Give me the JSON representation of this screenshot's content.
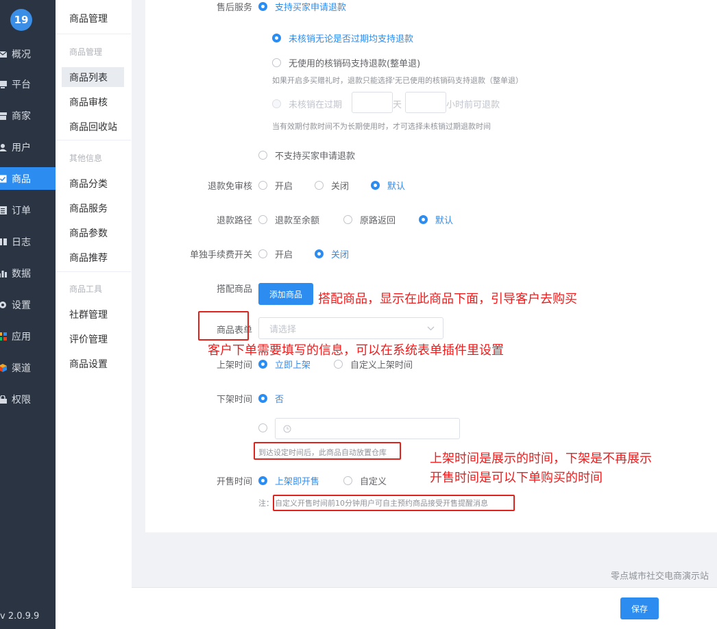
{
  "sidebar": {
    "logo": "19",
    "items": [
      {
        "label": "概况",
        "icon": "mail-icon"
      },
      {
        "label": "平台",
        "icon": "monitor-icon"
      },
      {
        "label": "商家",
        "icon": "store-icon"
      },
      {
        "label": "用户",
        "icon": "user-icon"
      },
      {
        "label": "商品",
        "icon": "checkbox-icon"
      },
      {
        "label": "订单",
        "icon": "list-icon"
      },
      {
        "label": "日志",
        "icon": "book-icon"
      },
      {
        "label": "数据",
        "icon": "bar-chart-icon"
      },
      {
        "label": "设置",
        "icon": "gear-icon"
      },
      {
        "label": "应用",
        "icon": "apps-icon"
      },
      {
        "label": "渠道",
        "icon": "cube-icon"
      },
      {
        "label": "权限",
        "icon": "lock-icon"
      }
    ],
    "version": "v 2.0.9.9",
    "accent": "#2d8cf0"
  },
  "submenu": {
    "title": "商品管理",
    "groups": [
      {
        "name": "商品管理",
        "items": [
          "商品列表",
          "商品审核",
          "商品回收站"
        ]
      },
      {
        "name": "其他信息",
        "items": [
          "商品分类",
          "商品服务",
          "商品参数",
          "商品推荐"
        ]
      },
      {
        "name": "商品工具",
        "items": [
          "社群管理",
          "评价管理",
          "商品设置"
        ]
      }
    ]
  },
  "form": {
    "after_sale": {
      "label": "售后服务",
      "support": "支持买家申请退款",
      "opt_expired": "未核销无论是否过期均支持退款",
      "opt_unused": "无使用的核销码支持退款(整单退)",
      "hint_unused": "如果开启多买赠礼时，退款只能选择'无已使用的核销码支持退款（整单退）",
      "opt_before_prefix": "未核销在过期",
      "opt_before_day": "天",
      "opt_before_suffix": "小时前可退款",
      "hint_before": "当有效期付款时间不为长期使用时，才可选择未核销过期退款时间",
      "not_support": "不支持买家申请退款"
    },
    "refund_audit": {
      "label": "退款免审核",
      "options": [
        "开启",
        "关闭",
        "默认"
      ]
    },
    "refund_path": {
      "label": "退款路径",
      "options": [
        "退款至余额",
        "原路返回",
        "默认"
      ]
    },
    "fee_switch": {
      "label": "单独手续费开关",
      "options": [
        "开启",
        "关闭"
      ]
    },
    "bundle": {
      "label": "搭配商品",
      "button": "添加商品"
    },
    "goods_form": {
      "label": "商品表单",
      "placeholder": "请选择"
    },
    "on_shelf": {
      "label": "上架时间",
      "options": [
        "立即上架",
        "自定义上架时间"
      ]
    },
    "off_shelf": {
      "label": "下架时间",
      "option_no": "否",
      "hint": "到达设定时间后，此商品自动放置仓库"
    },
    "sale_time": {
      "label": "开售时间",
      "options": [
        "上架即开售",
        "自定义"
      ],
      "note_prefix": "注：",
      "note": "自定义开售时间前10分钟用户可自主预约商品接受开售提醒消息"
    }
  },
  "annotations": {
    "bundle": "搭配商品，显示在此商品下面，引导客户去购买",
    "form": "客户下单需要填写的信息，可以在系统表单插件里设置",
    "shelf_line1": "上架时间是展示的时间，下架是不再展示",
    "shelf_line2": "开售时间是可以下单购买的时间",
    "color": "#ee1c1c"
  },
  "footer": {
    "site": "零点城市社交电商演示站",
    "save": "保存"
  }
}
